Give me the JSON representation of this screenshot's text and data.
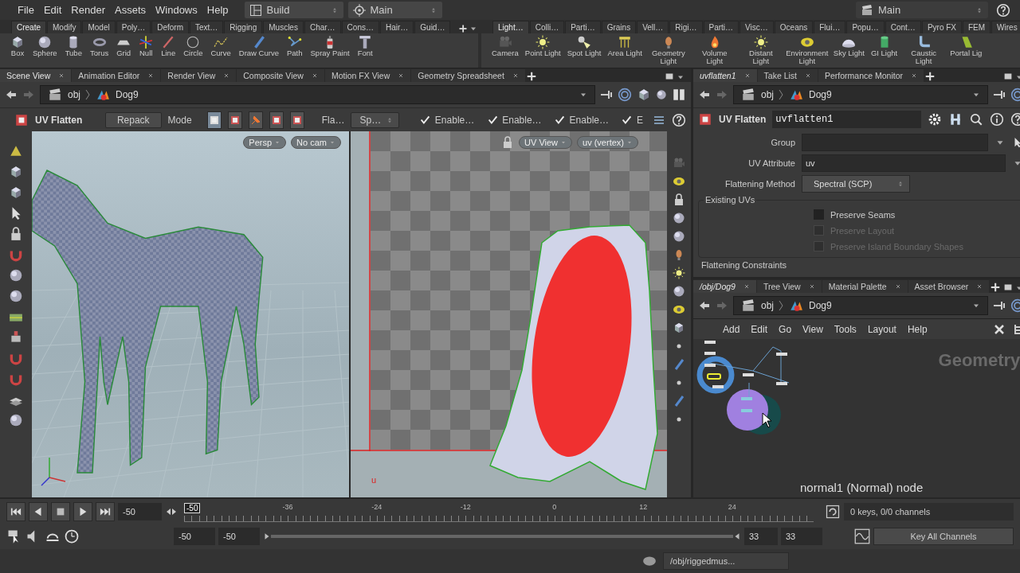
{
  "menu_bar": {
    "items": [
      "File",
      "Edit",
      "Render",
      "Assets",
      "Windows",
      "Help"
    ],
    "desktop": "Build",
    "context": "Main",
    "scene": "Main"
  },
  "shelves": [
    {
      "tabs": [
        {
          "label": "Create",
          "selected": true
        },
        {
          "label": "Modify",
          "selected": false
        },
        {
          "label": "Model",
          "selected": false
        },
        {
          "label": "Poly…",
          "selected": false
        },
        {
          "label": "Deform",
          "selected": false
        },
        {
          "label": "Text…",
          "selected": false
        },
        {
          "label": "Rigging",
          "selected": false
        },
        {
          "label": "Muscles",
          "selected": false
        },
        {
          "label": "Char…",
          "selected": false
        },
        {
          "label": "Cons…",
          "selected": false
        },
        {
          "label": "Hair…",
          "selected": false
        },
        {
          "label": "Guid…",
          "selected": false
        }
      ],
      "tools": [
        "Box",
        "Sphere",
        "Tube",
        "Torus",
        "Grid",
        "Null",
        "Line",
        "Circle",
        "Curve",
        "Draw Curve",
        "Path",
        "Spray Paint",
        "Font"
      ]
    },
    {
      "tabs": [
        {
          "label": "Light…",
          "selected": true
        },
        {
          "label": "Colli…",
          "selected": false
        },
        {
          "label": "Parti…",
          "selected": false
        },
        {
          "label": "Grains",
          "selected": false
        },
        {
          "label": "Vell…",
          "selected": false
        },
        {
          "label": "Rigi…",
          "selected": false
        },
        {
          "label": "Parti…",
          "selected": false
        },
        {
          "label": "Visc…",
          "selected": false
        },
        {
          "label": "Oceans",
          "selected": false
        },
        {
          "label": "Flui…",
          "selected": false
        },
        {
          "label": "Popu…",
          "selected": false
        },
        {
          "label": "Cont…",
          "selected": false
        },
        {
          "label": "Pyro FX",
          "selected": false
        },
        {
          "label": "FEM",
          "selected": false
        },
        {
          "label": "Wires",
          "selected": false
        }
      ],
      "tools": [
        "Camera",
        "Point Light",
        "Spot Light",
        "Area Light",
        "Geometry Light",
        "Volume Light",
        "Distant Light",
        "Environment Light",
        "Sky Light",
        "GI Light",
        "Caustic Light",
        "Portal Lig"
      ]
    }
  ],
  "scene_pane": {
    "tabs": [
      {
        "label": "Scene View",
        "selected": true
      },
      {
        "label": "Animation Editor",
        "selected": false
      },
      {
        "label": "Render View",
        "selected": false
      },
      {
        "label": "Composite View",
        "selected": false
      },
      {
        "label": "Motion FX View",
        "selected": false
      },
      {
        "label": "Geometry Spreadsheet",
        "selected": false
      }
    ],
    "path": [
      "obj",
      "Dog9"
    ],
    "operator": {
      "name": "UV Flatten",
      "repack": "Repack",
      "mode_label": "Mode",
      "method_label": "Fla…",
      "method_value": "Sp…",
      "toggles": [
        {
          "label": "Enable…",
          "checked": true
        },
        {
          "label": "Enable…",
          "checked": true
        },
        {
          "label": "Enable…",
          "checked": true
        },
        {
          "label": "E",
          "checked": true
        }
      ]
    },
    "viewport": {
      "camera": "Persp",
      "camera_menu": "No cam"
    },
    "uv_view": {
      "view": "UV View",
      "attribute": "uv (vertex)",
      "axis_label": "u"
    }
  },
  "parameters_pane": {
    "tabs": [
      {
        "label": "uvflatten1",
        "selected": true
      },
      {
        "label": "Take List",
        "selected": false
      },
      {
        "label": "Performance Monitor",
        "selected": false
      }
    ],
    "path": [
      "obj",
      "Dog9"
    ],
    "node_type": "UV Flatten",
    "node_name": "uvflatten1",
    "fields": [
      {
        "label": "Group"
      },
      {
        "label": "UV Attribute",
        "value": "uv"
      }
    ],
    "method": {
      "label": "Flattening Method",
      "value": "Spectral (SCP)"
    },
    "section": "Existing UVs",
    "options": [
      {
        "label": "Preserve Seams",
        "checked": false,
        "disabled": false
      },
      {
        "label": "Preserve Layout",
        "checked": false,
        "disabled": true
      },
      {
        "label": "Preserve Island Boundary Shapes",
        "checked": false,
        "disabled": true
      }
    ],
    "next_section": "Flattening Constraints"
  },
  "network_pane": {
    "tabs": [
      {
        "label": "/obj/Dog9",
        "selected": true
      },
      {
        "label": "Tree View",
        "selected": false
      },
      {
        "label": "Material Palette",
        "selected": false
      },
      {
        "label": "Asset Browser",
        "selected": false
      }
    ],
    "path": [
      "obj",
      "Dog9"
    ],
    "menu": [
      "Add",
      "Edit",
      "Go",
      "View",
      "Tools",
      "Layout",
      "Help"
    ],
    "context_label": "Geometry",
    "hover_info": "normal1 (Normal) node"
  },
  "timeline": {
    "frame": "-50",
    "marker": "-50",
    "ticks": [
      "-36",
      "-24",
      "-12",
      "0",
      "12",
      "24"
    ],
    "start": "-50",
    "range_start": "-50",
    "range_end": "33",
    "end": "33",
    "keys": "0 keys, 0/0 channels",
    "key_button": "Key All Channels"
  },
  "status_bar": {
    "path": "/obj/riggedmus..."
  }
}
